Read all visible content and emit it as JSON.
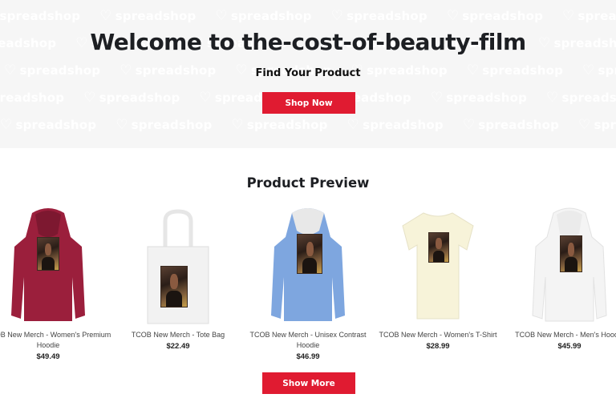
{
  "hero": {
    "watermark_text": "spreadshop",
    "title": "Welcome to the-cost-of-beauty-film",
    "subtitle": "Find Your Product",
    "shop_button": "Shop Now"
  },
  "preview": {
    "title": "Product Preview",
    "show_more_button": "Show More",
    "products": [
      {
        "name": "TCOB New Merch - Women's Premium Hoodie",
        "price": "$49.49",
        "color": "#9b1f3c",
        "kind": "hoodie"
      },
      {
        "name": "TCOB New Merch - Tote Bag",
        "price": "$22.49",
        "color": "#f2f2f2",
        "kind": "tote"
      },
      {
        "name": "TCOB New Merch - Unisex Contrast Hoodie",
        "price": "$46.99",
        "color": "#7ea6df",
        "kind": "hoodie"
      },
      {
        "name": "TCOB New Merch - Women's T-Shirt",
        "price": "$28.99",
        "color": "#f7f3d9",
        "kind": "tshirt"
      },
      {
        "name": "TCOB New Merch - Men's Hoodie",
        "price": "$45.99",
        "color": "#f4f4f4",
        "kind": "hoodie"
      }
    ]
  },
  "colors": {
    "accent": "#e01b31",
    "hero_bg": "#f6f6f6"
  }
}
